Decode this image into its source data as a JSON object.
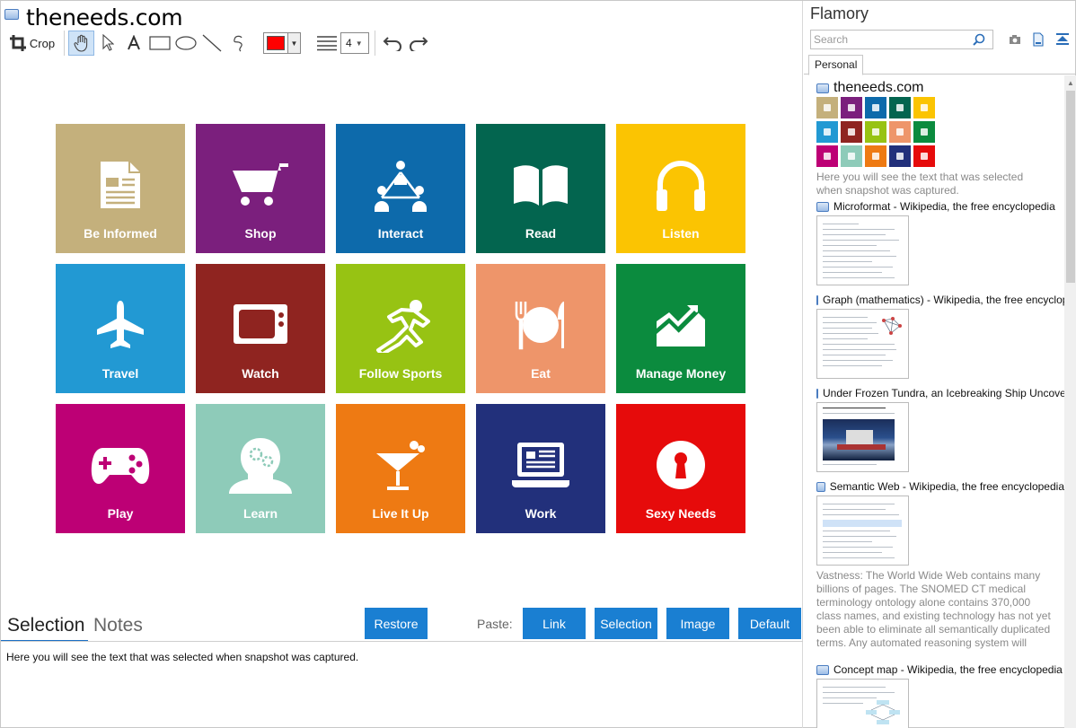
{
  "window": {
    "title": "theneeds.com"
  },
  "toolbar": {
    "crop_label": "Crop",
    "color": "#ff0000",
    "line_width": "4",
    "tools": [
      "hand-icon",
      "pointer-icon",
      "text-icon",
      "rectangle-icon",
      "ellipse-icon",
      "line-icon",
      "freehand-icon"
    ]
  },
  "tiles": [
    {
      "label": "Be Informed",
      "color": "#c4b07c",
      "icon": "newspaper-icon"
    },
    {
      "label": "Shop",
      "color": "#7b1f7d",
      "icon": "cart-icon"
    },
    {
      "label": "Interact",
      "color": "#0d6aab",
      "icon": "network-icon"
    },
    {
      "label": "Read",
      "color": "#03654f",
      "icon": "book-icon"
    },
    {
      "label": "Listen",
      "color": "#fbc402",
      "icon": "headphones-icon"
    },
    {
      "label": "Travel",
      "color": "#2299d3",
      "icon": "airplane-icon"
    },
    {
      "label": "Watch",
      "color": "#8f2420",
      "icon": "tv-icon"
    },
    {
      "label": "Follow Sports",
      "color": "#97c313",
      "icon": "runner-icon"
    },
    {
      "label": "Eat",
      "color": "#ee956a",
      "icon": "plate-icon"
    },
    {
      "label": "Manage Money",
      "color": "#0b8b3e",
      "icon": "chart-icon"
    },
    {
      "label": "Play",
      "color": "#bd0075",
      "icon": "gamepad-icon"
    },
    {
      "label": "Learn",
      "color": "#8ecbb9",
      "icon": "head-gears-icon"
    },
    {
      "label": "Live It Up",
      "color": "#ee7a13",
      "icon": "cocktail-icon"
    },
    {
      "label": "Work",
      "color": "#22307b",
      "icon": "laptop-icon"
    },
    {
      "label": "Sexy Needs",
      "color": "#e60b0b",
      "icon": "keyhole-icon"
    }
  ],
  "bottom": {
    "tab_selection": "Selection",
    "tab_notes": "Notes",
    "restore_label": "Restore",
    "paste_label": "Paste:",
    "paste_link": "Link",
    "paste_selection": "Selection",
    "paste_image": "Image",
    "paste_default": "Default",
    "selection_text": "Here you will see the text that was selected when snapshot was captured."
  },
  "flamory": {
    "title": "Flamory",
    "search_placeholder": "Search",
    "tab": "Personal",
    "items": [
      {
        "title": "theneeds.com",
        "desc": "Here you will see the text that was selected when snapshot was captured."
      },
      {
        "title": "Microformat - Wikipedia, the free encyclopedia"
      },
      {
        "title": "Graph (mathematics) - Wikipedia, the free encyclopedia"
      },
      {
        "title": "Under Frozen Tundra, an Icebreaking Ship Uncovers"
      },
      {
        "title": "Semantic Web - Wikipedia, the free encyclopedia",
        "desc": "Vastness: The World Wide Web contains many billions of pages. The SNOMED CT medical terminology ontology alone contains 370,000 class names, and existing technology has not yet been able to eliminate all semantically duplicated terms. Any automated reasoning system will have to deal with truly huge inputs."
      },
      {
        "title": "Concept map - Wikipedia, the free encyclopedia"
      }
    ]
  }
}
